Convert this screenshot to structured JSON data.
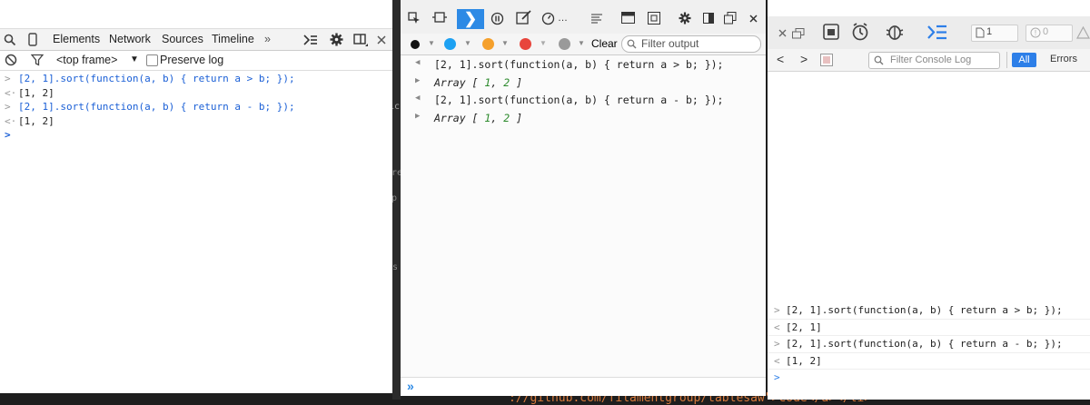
{
  "chrome": {
    "tabs": [
      "Elements",
      "Network",
      "Sources",
      "Timeline",
      "»"
    ],
    "frame_selector": "<top frame>",
    "frame_arrow": "▼",
    "preserve_log": "Preserve log",
    "console": [
      {
        "prefix": ">",
        "text": "[2, 1].sort(function(a, b) { return a > b; });",
        "kind": "input"
      },
      {
        "prefix": "<·",
        "text": "[1, 2]",
        "kind": "output"
      },
      {
        "prefix": ">",
        "text": "[2, 1].sort(function(a, b) { return a - b; });",
        "kind": "input"
      },
      {
        "prefix": "<·",
        "text": "[1, 2]",
        "kind": "output"
      }
    ],
    "prompt": ">"
  },
  "firefox": {
    "clear_label": "Clear",
    "filter_placeholder": "Filter output",
    "console": [
      {
        "prefix": "◀",
        "text": "[2, 1].sort(function(a, b) { return a > b; });",
        "kind": "input"
      },
      {
        "prefix": "▶",
        "text": "Array [ 1, 2 ]",
        "kind": "output"
      },
      {
        "prefix": "◀",
        "text": "[2, 1].sort(function(a, b) { return a - b; });",
        "kind": "input"
      },
      {
        "prefix": "▶",
        "text": "Array [ 1, 2 ]",
        "kind": "output"
      }
    ],
    "prompt": "»",
    "colors": {
      "blue": "#1da1f2",
      "orange": "#f5a02c",
      "red": "#e8453c",
      "gray": "#9a9a9a",
      "accent": "#2d8ae5"
    }
  },
  "safari": {
    "doc_count": "1",
    "error_count": "0",
    "filter_placeholder": "Filter Console Log",
    "all_label": "All",
    "errors_label": "Errors",
    "console": [
      {
        "prefix": ">",
        "text": "[2, 1].sort(function(a, b) { return a > b; });",
        "kind": "input"
      },
      {
        "prefix": "<",
        "text": "[2, 1]",
        "kind": "output"
      },
      {
        "prefix": ">",
        "text": "[2, 1].sort(function(a, b) { return a - b; });",
        "kind": "input"
      },
      {
        "prefix": "<",
        "text": "[1, 2]",
        "kind": "output"
      }
    ],
    "prompt": ">"
  },
  "background": {
    "fragment_bottom": "://github.com/filamentgroup/tablesaw\">Code</a></li>",
    "gutter_chars": [
      "ic",
      "re",
      "p",
      "s"
    ]
  }
}
